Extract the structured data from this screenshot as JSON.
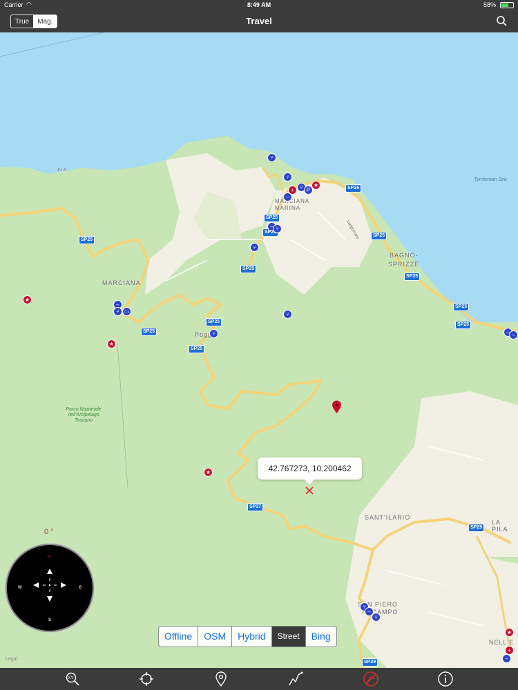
{
  "status_bar": {
    "carrier": "Carrier",
    "time": "8:49 AM",
    "battery": "58%"
  },
  "nav": {
    "title": "Travel",
    "north_toggle": [
      "True",
      "Mag."
    ],
    "north_selected": "Mag."
  },
  "map": {
    "places": {
      "marciana": "MARCIANA",
      "poggio": "Poggio",
      "marciana_marina": "MARCIANA MARINA",
      "bagno": "BAGNO-",
      "sprizze": "SPRIZZE",
      "sant_ilario": "SANT'ILARIO",
      "la_pila": "LA PILA",
      "san_piero_1": "SAN PIERO",
      "san_piero_2": "IN CAMPO",
      "aia": "AIA",
      "nell_el": "NELL'E",
      "park": "Parco Nazionale dell'Arcipelago Toscano",
      "sea": "Tyrrhenian Sea",
      "road_street": "Lungomare"
    },
    "roads": [
      "SP25",
      "SP37",
      "SP29"
    ],
    "coordinate": "42.767273, 10.200462",
    "heading": "0 °",
    "compass": {
      "n": "n",
      "s": "s",
      "e": "e",
      "w": "w"
    },
    "legal": "Legal",
    "map_types": [
      "Offline",
      "OSM",
      "Hybrid",
      "Street",
      "Bing"
    ],
    "map_type_selected": "Street"
  },
  "toolbar": {
    "icons": [
      "xy-search-icon",
      "locate-icon",
      "pin-icon",
      "route-icon",
      "no-tracking-icon",
      "info-icon"
    ],
    "accent": "#d0312d"
  },
  "colors": {
    "sea": "#a7dbf3",
    "land": "#c8e6b5",
    "road": "#f4d37a",
    "poi": "#2d44c8",
    "bar": "#3b3b3b"
  }
}
